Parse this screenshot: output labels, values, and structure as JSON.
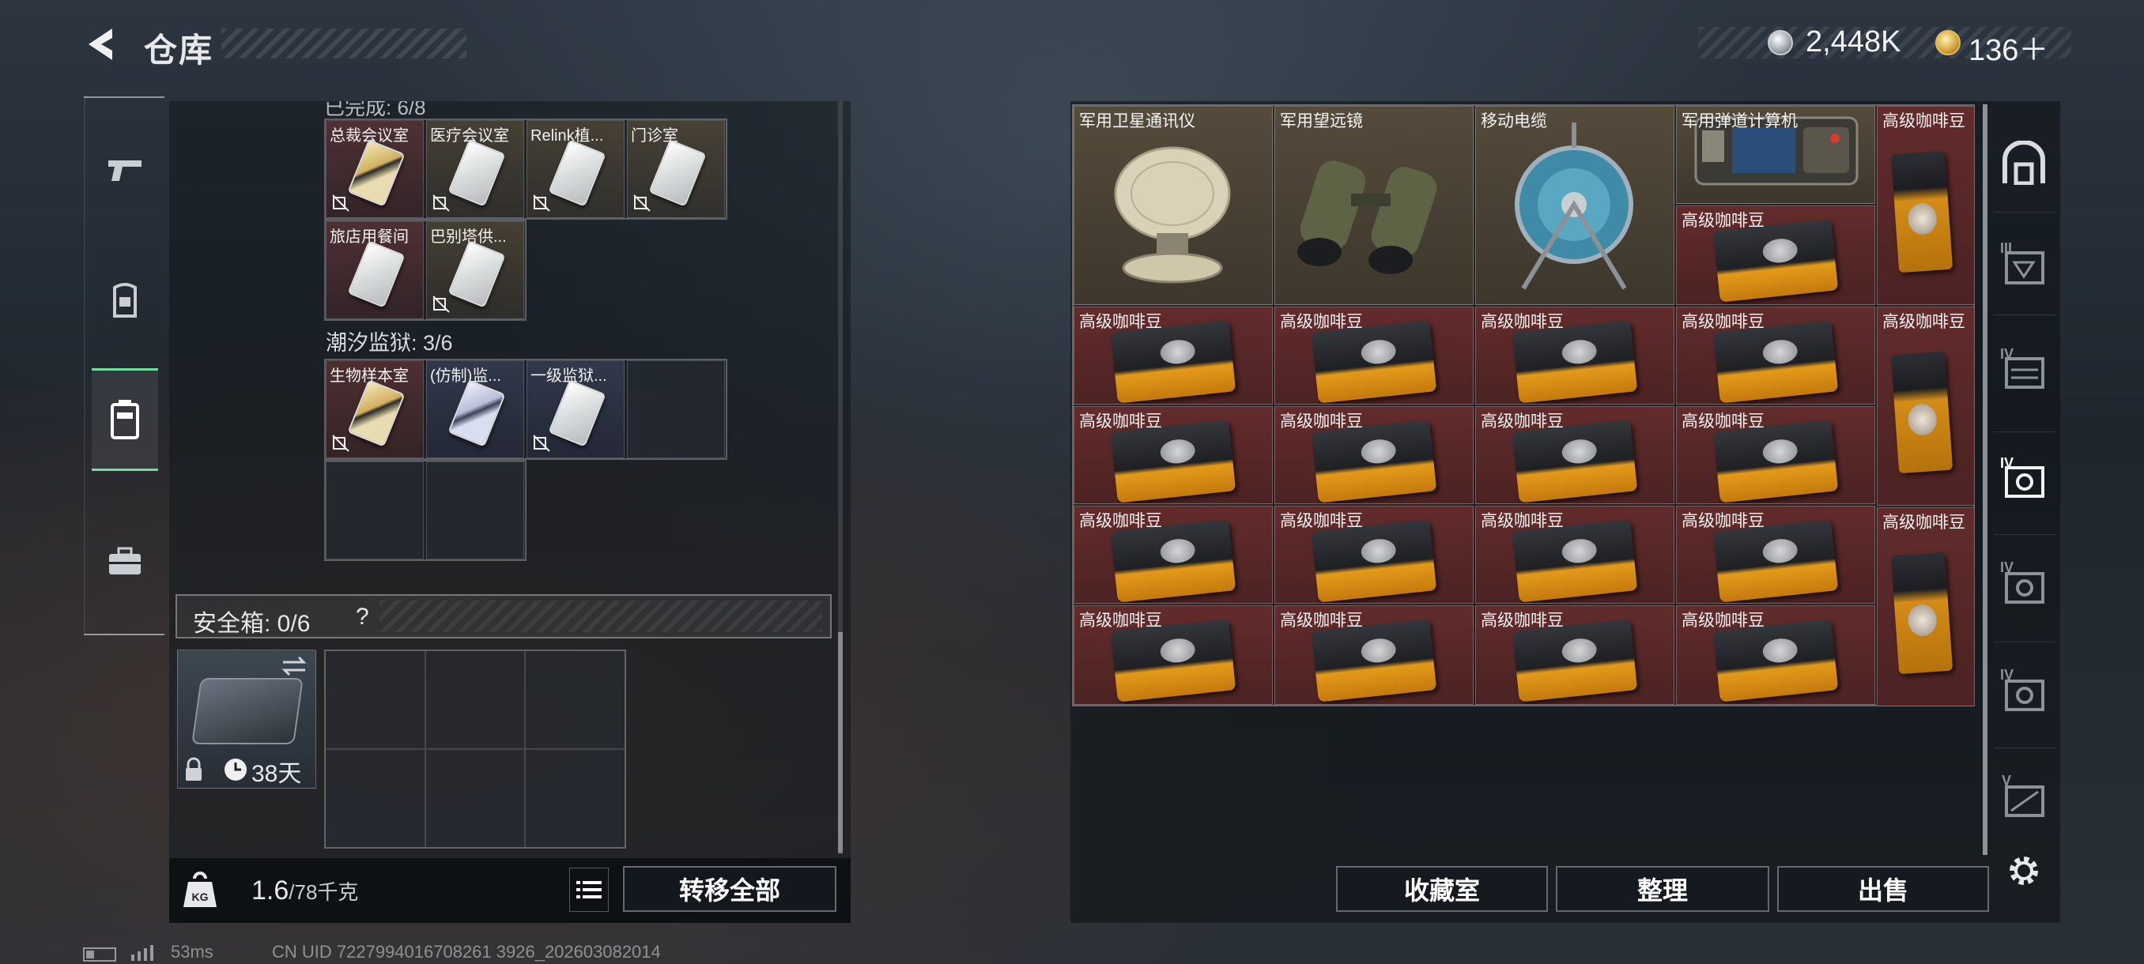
{
  "header": {
    "title": "仓库",
    "currency": {
      "silver": "2,448K",
      "gold": "136＋"
    }
  },
  "left": {
    "cut_label": "已完成: 6/8",
    "row1_items": [
      "总裁会议室",
      "医疗会议室",
      "Relink植...",
      "门诊室"
    ],
    "row2_items": [
      "旅店用餐间",
      "巴别塔供..."
    ],
    "section_tide": "潮汐监狱: 3/6",
    "row3_items": [
      "生物样本室",
      "(仿制)监...",
      "一级监狱..."
    ],
    "safe_label": "安全箱: 0/6",
    "safe_help": "?",
    "safe_days": "38天",
    "weight_value": "1.6",
    "weight_max": "/78千克",
    "transfer_all": "转移全部"
  },
  "right": {
    "items_top": [
      "军用卫星通讯仪",
      "军用望远镜",
      "移动电缆",
      "军用弹道计算机",
      "高级咖啡豆",
      "高级咖啡豆"
    ],
    "coffee_label": "高级咖啡豆",
    "buttons": {
      "collection": "收藏室",
      "organize": "整理",
      "sell": "出售"
    }
  },
  "status": {
    "ping": "53ms",
    "uid": "CN UID 7227994016708261 3926_202603082014"
  },
  "tiers": [
    "III",
    "IV",
    "IV",
    "IV",
    "IV",
    "V"
  ]
}
